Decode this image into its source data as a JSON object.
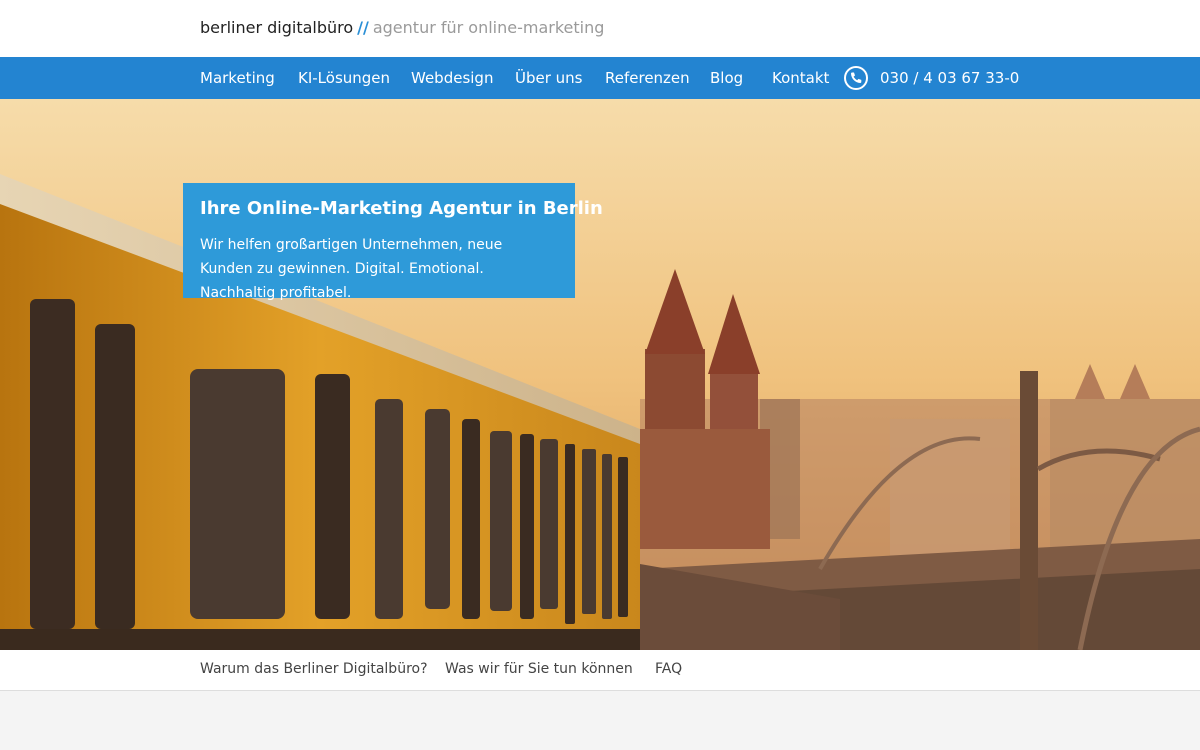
{
  "header": {
    "brand": "berliner digitalbüro",
    "separator": "//",
    "tagline": "agentur für online-marketing"
  },
  "nav": {
    "items": [
      "Marketing",
      "KI-Lösungen",
      "Webdesign",
      "Über uns",
      "Referenzen",
      "Blog",
      "Kontakt"
    ],
    "phone_icon": "phone-icon",
    "phone": "030 / 4 03 67 33-0"
  },
  "hero": {
    "title": "Ihre Online-Marketing Agentur in Berlin",
    "text": "Wir helfen großartigen Unternehmen, neue Kunden zu gewinnen. Digital. Emotional. Nachhaltig profitabel."
  },
  "subnav": {
    "items": [
      "Warum das Berliner Digitalbüro?",
      "Was wir für Sie tun können",
      "FAQ"
    ]
  },
  "colors": {
    "nav_bg": "#2384d1",
    "accent": "#2e9ad9",
    "separator": "#2a8fd6"
  }
}
